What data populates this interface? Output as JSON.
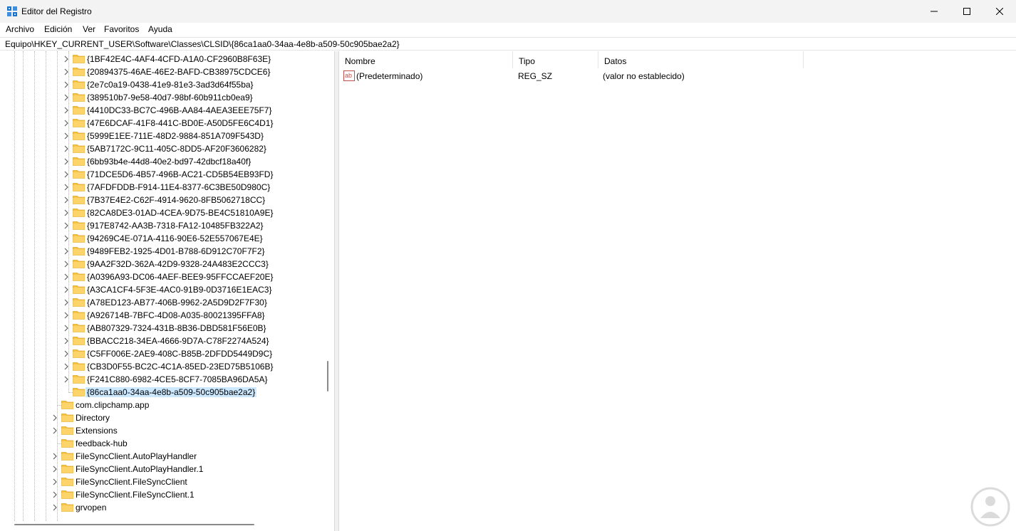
{
  "window": {
    "title": "Editor del Registro",
    "icon": "regedit-icon"
  },
  "menu": [
    "Archivo",
    "Edición",
    "Ver",
    "Favoritos",
    "Ayuda"
  ],
  "address": "Equipo\\HKEY_CURRENT_USER\\Software\\Classes\\CLSID\\{86ca1aa0-34aa-4e8b-a509-50c905bae2a2}",
  "tree": {
    "clsid_children": [
      "{1BF42E4C-4AF4-4CFD-A1A0-CF2960B8F63E}",
      "{20894375-46AE-46E2-BAFD-CB38975CDCE6}",
      "{2e7c0a19-0438-41e9-81e3-3ad3d64f55ba}",
      "{389510b7-9e58-40d7-98bf-60b911cb0ea9}",
      "{4410DC33-BC7C-496B-AA84-4AEA3EEE75F7}",
      "{47E6DCAF-41F8-441C-BD0E-A50D5FE6C4D1}",
      "{5999E1EE-711E-48D2-9884-851A709F543D}",
      "{5AB7172C-9C11-405C-8DD5-AF20F3606282}",
      "{6bb93b4e-44d8-40e2-bd97-42dbcf18a40f}",
      "{71DCE5D6-4B57-496B-AC21-CD5B54EB93FD}",
      "{7AFDFDDB-F914-11E4-8377-6C3BE50D980C}",
      "{7B37E4E2-C62F-4914-9620-8FB5062718CC}",
      "{82CA8DE3-01AD-4CEA-9D75-BE4C51810A9E}",
      "{917E8742-AA3B-7318-FA12-10485FB322A2}",
      "{94269C4E-071A-4116-90E6-52E557067E4E}",
      "{9489FEB2-1925-4D01-B788-6D912C70F7F2}",
      "{9AA2F32D-362A-42D9-9328-24A483E2CCC3}",
      "{A0396A93-DC06-4AEF-BEE9-95FFCCAEF20E}",
      "{A3CA1CF4-5F3E-4AC0-91B9-0D3716E1EAC3}",
      "{A78ED123-AB77-406B-9962-2A5D9D2F7F30}",
      "{A926714B-7BFC-4D08-A035-80021395FFA8}",
      "{AB807329-7324-431B-8B36-DBD581F56E0B}",
      "{BBACC218-34EA-4666-9D7A-C78F2274A524}",
      "{C5FF006E-2AE9-408C-B85B-2DFDD5449D9C}",
      "{CB3D0F55-BC2C-4C1A-85ED-23ED75B5106B}",
      "{F241C880-6982-4CE5-8CF7-7085BA96DA5A}"
    ],
    "selected": "{86ca1aa0-34aa-4e8b-a509-50c905bae2a2}",
    "classes_children": [
      {
        "label": "com.clipchamp.app",
        "expandable": false
      },
      {
        "label": "Directory",
        "expandable": true
      },
      {
        "label": "Extensions",
        "expandable": true
      },
      {
        "label": "feedback-hub",
        "expandable": false
      },
      {
        "label": "FileSyncClient.AutoPlayHandler",
        "expandable": true
      },
      {
        "label": "FileSyncClient.AutoPlayHandler.1",
        "expandable": true
      },
      {
        "label": "FileSyncClient.FileSyncClient",
        "expandable": true
      },
      {
        "label": "FileSyncClient.FileSyncClient.1",
        "expandable": true
      },
      {
        "label": "grvopen",
        "expandable": true
      }
    ]
  },
  "values": {
    "columns": [
      "Nombre",
      "Tipo",
      "Datos"
    ],
    "rows": [
      {
        "name": "(Predeterminado)",
        "type": "REG_SZ",
        "data": "(valor no establecido)",
        "icon": "string-value-icon"
      }
    ]
  },
  "colors": {
    "selection": "#cce8ff",
    "folder": "#f8c443",
    "titlebar": "#f3f3f3"
  }
}
